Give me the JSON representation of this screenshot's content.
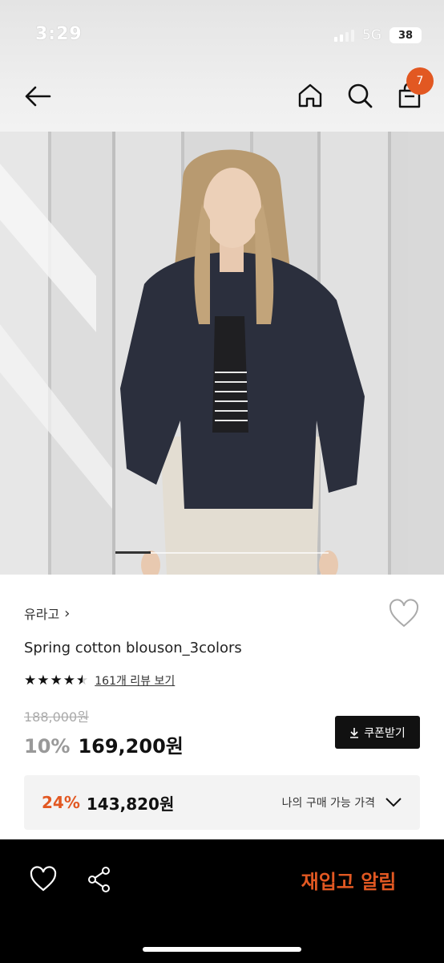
{
  "status_bar": {
    "time": "3:29",
    "network": "5G",
    "battery": "38"
  },
  "header": {
    "cart_count": "7"
  },
  "product": {
    "brand": "유라고",
    "brand_chevron": "›",
    "name": "Spring cotton blouson_3colors",
    "rating_stars": 4.5,
    "review_link": "161개 리뷰 보기",
    "original_price": "188,000원",
    "discount_rate": "10%",
    "sale_price": "169,200원",
    "coupon_button": "쿠폰받기",
    "my_price": {
      "discount": "24%",
      "price": "143,820원",
      "label": "나의 구매 가능 가격"
    }
  },
  "bottom_bar": {
    "restock_button": "재입고 알림"
  },
  "colors": {
    "accent": "#e25822",
    "dark": "#111111",
    "bottom_bar": "#000000"
  }
}
